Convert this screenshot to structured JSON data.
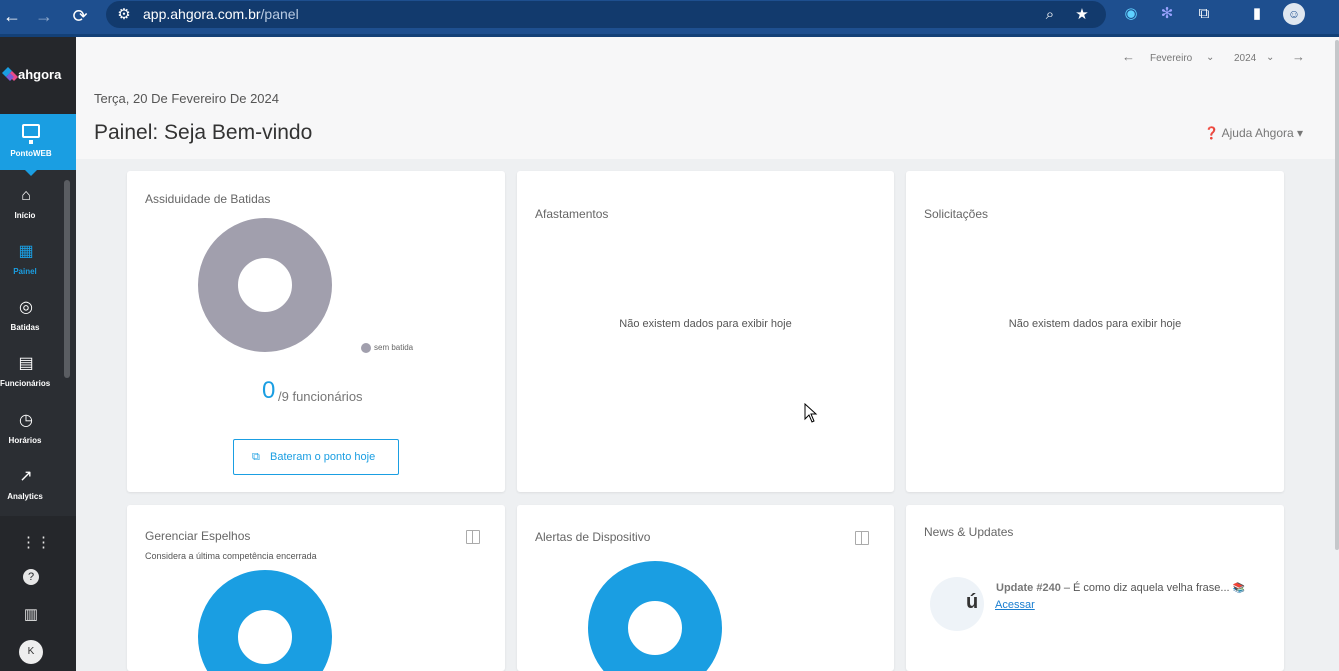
{
  "browser": {
    "url_host": "app.ahgora.com.br",
    "url_path": "/panel"
  },
  "sidebar": {
    "brand": "ahgora",
    "product": "PontoWEB",
    "items": [
      {
        "label": "Início",
        "icon": "home-icon"
      },
      {
        "label": "Painel",
        "icon": "dashboard-icon",
        "active": true
      },
      {
        "label": "Batidas",
        "icon": "fingerprint-icon"
      },
      {
        "label": "Funcionários",
        "icon": "clipboard-icon"
      },
      {
        "label": "Horários",
        "icon": "clock-icon"
      },
      {
        "label": "Analytics",
        "icon": "trend-icon"
      }
    ],
    "user_initial": "K"
  },
  "header": {
    "month": "Fevereiro",
    "year": "2024",
    "date": "Terça, 20 De Fevereiro De 2024",
    "title": "Painel: Seja Bem-vindo",
    "help": "Ajuda Ahgora"
  },
  "cards": {
    "assiduidade": {
      "title": "Assiduidade de Batidas",
      "legend": "sem batida",
      "count": "0",
      "count_suffix": "/9 funcionários",
      "button": "Bateram o ponto hoje"
    },
    "afastamentos": {
      "title": "Afastamentos",
      "empty": "Não existem dados para exibir hoje"
    },
    "solicitacoes": {
      "title": "Solicitações",
      "empty": "Não existem dados para exibir hoje"
    },
    "espelhos": {
      "title": "Gerenciar Espelhos",
      "subtitle": "Considera a última competência encerrada"
    },
    "alertas": {
      "title": "Alertas de Dispositivo"
    },
    "news": {
      "title": "News & Updates",
      "update_label": "Update #240",
      "update_text": " – É como diz aquela velha frase...",
      "link": "Acessar"
    }
  },
  "colors": {
    "accent": "#1a9ee2",
    "donut_gray": "#a19fad",
    "sidebar_bg": "#2b2e33"
  }
}
